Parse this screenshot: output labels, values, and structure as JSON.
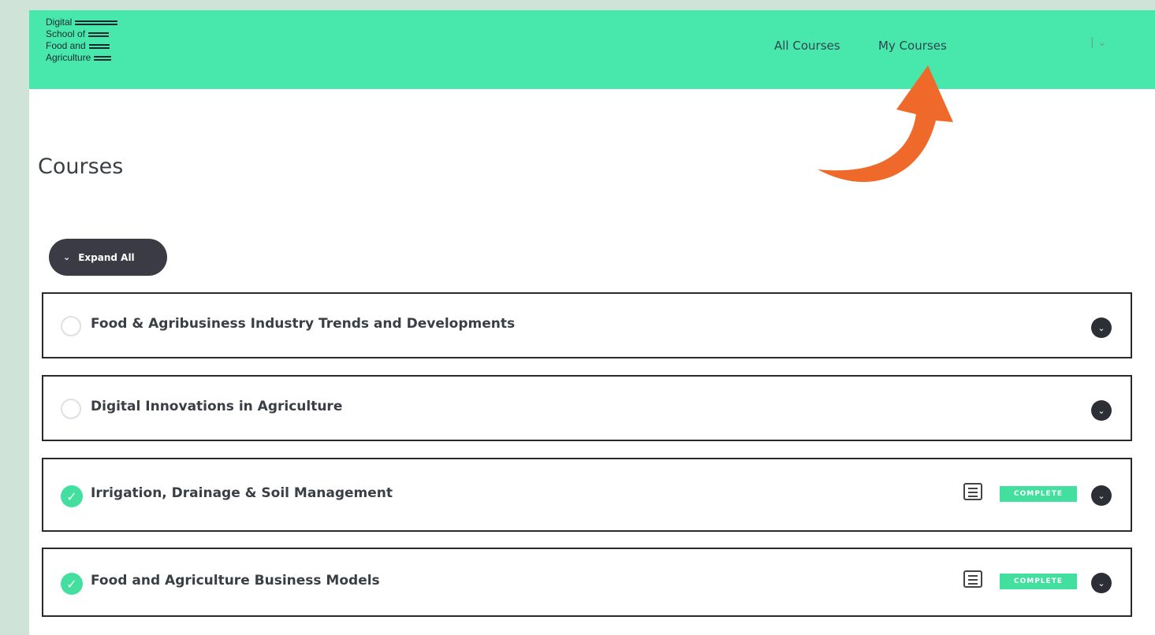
{
  "header": {
    "logo_lines": [
      "Digital",
      "School of",
      "Food and",
      "Agriculture"
    ],
    "nav": [
      {
        "label": "All Courses"
      },
      {
        "label": "My Courses"
      }
    ],
    "user_menu_caret": "| ⌄"
  },
  "main": {
    "title": "Courses",
    "expand_all_label": "Expand All",
    "badge_complete": "COMPLETE",
    "courses": [
      {
        "title": "Food & Agribusiness Industry Trends and Developments",
        "status": "not-started"
      },
      {
        "title": "Digital Innovations in Agriculture",
        "status": "not-started"
      },
      {
        "title": "Irrigation, Drainage & Soil Management",
        "status": "complete"
      },
      {
        "title": "Food and Agriculture Business Models",
        "status": "complete"
      }
    ]
  },
  "colors": {
    "header_bg": "#48e8ad",
    "accent_green": "#43df9f",
    "arrow_orange": "#ef6a2a",
    "dark_button": "#3b3b45",
    "outer_bg": "#cfe3d8"
  },
  "icons": [
    "chevron-down-icon",
    "check-icon",
    "certificate-icon",
    "curved-arrow-icon"
  ]
}
